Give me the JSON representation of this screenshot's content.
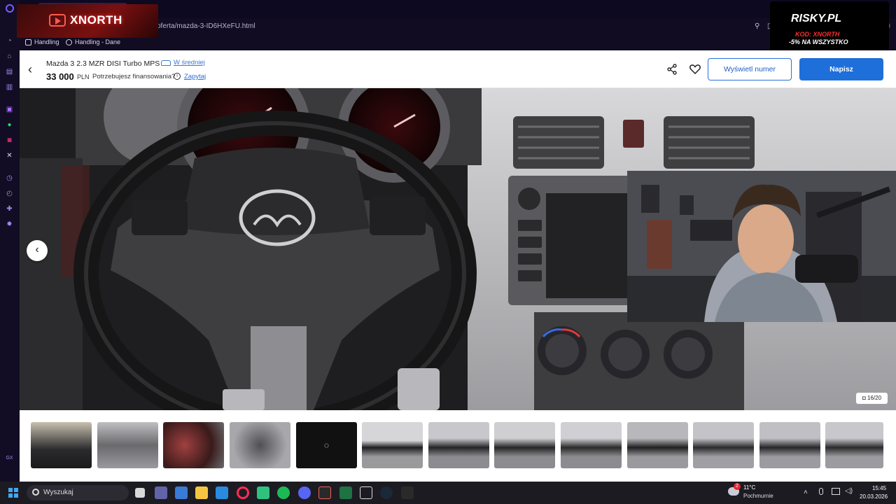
{
  "browser": {
    "url": "oferta/mazda-3-ID6HXeFU.html",
    "bookmarks": [
      {
        "label": "Handling"
      },
      {
        "label": "Handling - Dane"
      }
    ]
  },
  "overlays": {
    "xnorth_logo": "XNORTH",
    "risky": {
      "brand": "RISKY.PL",
      "code": "KOD: XNORTH",
      "promo": "-5% NA WSZYSTKO"
    }
  },
  "listing": {
    "title": "Mazda 3 2.3 MZR DISI Turbo MPS",
    "price_badge": "W średniej",
    "price": "33 000",
    "currency": "PLN",
    "financing_question": "Potrzebujesz finansowania?",
    "ask_link": "Zapytaj",
    "show_number_button": "Wyświetl numer",
    "write_button": "Napisz",
    "photo_counter": "16/20",
    "colors": {
      "primary": "#1e6fd9",
      "link": "#2a6fdb"
    }
  },
  "taskbar": {
    "search_label": "Wyszukaj",
    "weather_temp": "11°C",
    "weather_desc": "Pochmurnie",
    "weather_badge": "2",
    "time": "15:45",
    "date": "20.03.2026"
  }
}
